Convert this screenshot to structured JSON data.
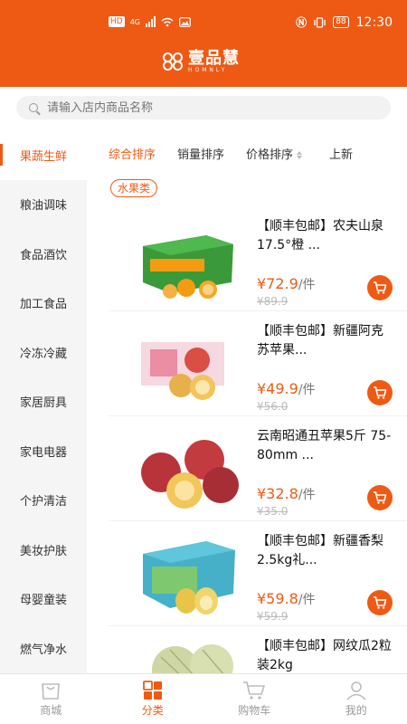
{
  "status_bar": {
    "network": "HD",
    "signal": "4G",
    "battery": "88",
    "time": "12:30"
  },
  "brand": {
    "name_cn": "壹品慧",
    "name_en": "HOMNLY"
  },
  "search": {
    "placeholder": "请输入店内商品名称"
  },
  "categories": [
    "果蔬生鲜",
    "粮油调味",
    "食品酒饮",
    "加工食品",
    "冷冻冷藏",
    "家居厨具",
    "家电电器",
    "个护清洁",
    "美妆护肤",
    "母婴童装",
    "燃气净水"
  ],
  "active_category": "果蔬生鲜",
  "sort_tabs": [
    "综合排序",
    "销量排序",
    "价格排序",
    "上新"
  ],
  "active_sort": "综合排序",
  "sub_tag": "水果类",
  "products": [
    {
      "title": "【顺丰包邮】农夫山泉17.5°橙 ...",
      "price": "¥72.9",
      "unit": "/件",
      "original_price": "¥89.9"
    },
    {
      "title": "【顺丰包邮】新疆阿克苏苹果...",
      "price": "¥49.9",
      "unit": "/件",
      "original_price": "¥56.0"
    },
    {
      "title": "云南昭通丑苹果5斤 75-80mm ...",
      "price": "¥32.8",
      "unit": "/件",
      "original_price": "¥35.0"
    },
    {
      "title": "【顺丰包邮】新疆香梨2.5kg礼...",
      "price": "¥59.8",
      "unit": "/件",
      "original_price": "¥59.9"
    },
    {
      "title": "【顺丰包邮】网纹瓜2粒装2kg",
      "price": "",
      "unit": "",
      "original_price": ""
    }
  ],
  "tabbar": [
    {
      "label": "商城",
      "icon": "shop-bag-icon"
    },
    {
      "label": "分类",
      "icon": "category-grid-icon"
    },
    {
      "label": "购物车",
      "icon": "cart-icon"
    },
    {
      "label": "我的",
      "icon": "user-icon"
    }
  ],
  "active_tab": "分类",
  "colors": {
    "accent": "#ee5a14",
    "sidebar_bg": "#f5f5f5",
    "muted": "#999999"
  }
}
